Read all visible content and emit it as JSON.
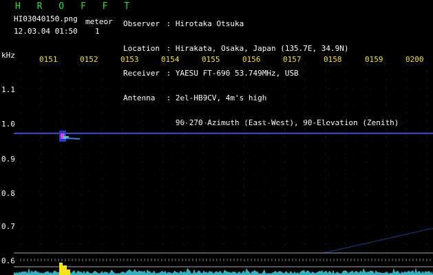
{
  "header": {
    "brand": "H R O F F T",
    "filename": "HI03040150.png",
    "meteor_label": "meteor",
    "timestamp": "12.03.04 01:50",
    "meteor_count": "1"
  },
  "info": {
    "observer_key": "Observer",
    "observer_val": "Hirotaka Otsuka",
    "location_key": "Location",
    "location_val": "Hirakata, Osaka, Japan (135.7E, 34.9N)",
    "receiver_key": "Receiver",
    "receiver_val": "YAESU FT-690 53.749MHz, USB",
    "antenna_key": "Antenna",
    "antenna_val": "2el-HB9CV, 4m's high",
    "antenna_val2": "90-270-Azimuth (East-West), 90-Elevation (Zenith)"
  },
  "axis": {
    "y_unit": "kHz",
    "x_ticks": [
      "0151",
      "0152",
      "0153",
      "0154",
      "0155",
      "0156",
      "0157",
      "0158",
      "0159",
      "0200"
    ],
    "y_ticks": [
      "1.1",
      "1.0",
      "0.9",
      "0.8",
      "0.7",
      "0.6"
    ]
  },
  "colors": {
    "background": "#000000",
    "header_green": "#33e033",
    "tick_yellow": "#f0e23c",
    "carrier": "#3a46d8",
    "noise_cyan": "#3fd0e0",
    "meteor_yellow": "#f4e21a"
  }
}
